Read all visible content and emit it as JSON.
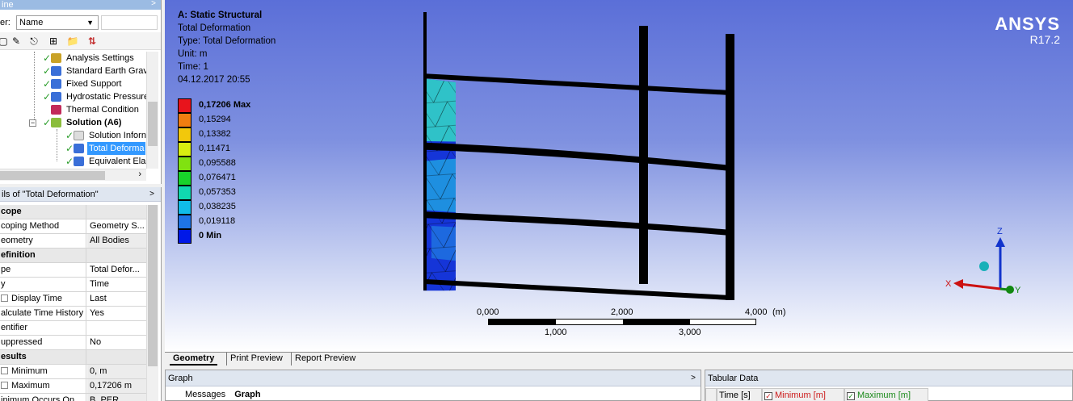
{
  "outline": {
    "title": "ine",
    "filter_label": "er:",
    "filter_value": "Name",
    "tree": [
      {
        "label": "Analysis Settings",
        "icon_color": "#c9a227"
      },
      {
        "label": "Standard Earth Grav",
        "icon_color": "#3a6fd8"
      },
      {
        "label": "Fixed Support",
        "icon_color": "#3a6fd8"
      },
      {
        "label": "Hydrostatic Pressure",
        "icon_color": "#3a6fd8"
      },
      {
        "label": "Thermal Condition",
        "icon_color": "#c22a5a"
      },
      {
        "label": "Solution (A6)",
        "icon_color": "#8bbd3c"
      },
      {
        "label": "Solution Inforn",
        "icon_color": "#dddddd"
      },
      {
        "label": "Total Deforma",
        "icon_color": "#3a6fd8"
      },
      {
        "label": "Equivalent Elas",
        "icon_color": "#3a6fd8"
      }
    ]
  },
  "details": {
    "title": "ils of \"Total Deformation\"",
    "rows": [
      {
        "k": "cope",
        "v": "",
        "group": true
      },
      {
        "k": "coping Method",
        "v": "Geometry S..."
      },
      {
        "k": "eometry",
        "v": "All Bodies"
      },
      {
        "k": "efinition",
        "v": "",
        "group": true
      },
      {
        "k": "pe",
        "v": "Total Defor..."
      },
      {
        "k": "y",
        "v": "Time"
      },
      {
        "k": "Display Time",
        "v": "Last"
      },
      {
        "k": "alculate Time History",
        "v": "Yes"
      },
      {
        "k": "entifier",
        "v": ""
      },
      {
        "k": "uppressed",
        "v": "No"
      },
      {
        "k": "esults",
        "v": "",
        "group": true
      },
      {
        "k": "Minimum",
        "v": "0, m"
      },
      {
        "k": "Maximum",
        "v": "0,17206 m"
      },
      {
        "k": "inimum Occurs On",
        "v": "B_PER..."
      }
    ]
  },
  "viewport": {
    "header": {
      "analysis": "A: Static Structural",
      "result": "Total Deformation",
      "type": "Type: Total Deformation",
      "unit": "Unit: m",
      "time": "Time: 1",
      "date": "04.12.2017 20:55"
    },
    "logo": {
      "brand": "ANSYS",
      "version": "R17.2"
    },
    "legend": [
      {
        "label": "0,17206 Max",
        "color": "#e8141c",
        "bold": true
      },
      {
        "label": "0,15294",
        "color": "#f07d10"
      },
      {
        "label": "0,13382",
        "color": "#f2c80c"
      },
      {
        "label": "0,11471",
        "color": "#d8ee10"
      },
      {
        "label": "0,095588",
        "color": "#80e210"
      },
      {
        "label": "0,076471",
        "color": "#18d32a"
      },
      {
        "label": "0,057353",
        "color": "#10d7b0"
      },
      {
        "label": "0,038235",
        "color": "#10bce8"
      },
      {
        "label": "0,019118",
        "color": "#1e74e6"
      },
      {
        "label": "0 Min",
        "color": "#0018e8",
        "bold": true
      }
    ],
    "scale": {
      "top_labels": [
        "0,000",
        "2,000",
        "4,000"
      ],
      "unit": "(m)",
      "bottom_labels": [
        "1,000",
        "3,000"
      ]
    },
    "triad": {
      "x": "X",
      "y": "Y",
      "z": "Z"
    }
  },
  "viewport_tabs": [
    "Geometry",
    "Print Preview",
    "Report Preview"
  ],
  "graph": {
    "title": "Graph",
    "tabs": [
      "Messages",
      "Graph"
    ]
  },
  "tabular": {
    "title": "Tabular Data",
    "columns": [
      "Time [s]",
      "Minimum [m]",
      "Maximum [m]"
    ],
    "column_colors": [
      "#000000",
      "#cc1a1a",
      "#1a8a1a"
    ]
  }
}
